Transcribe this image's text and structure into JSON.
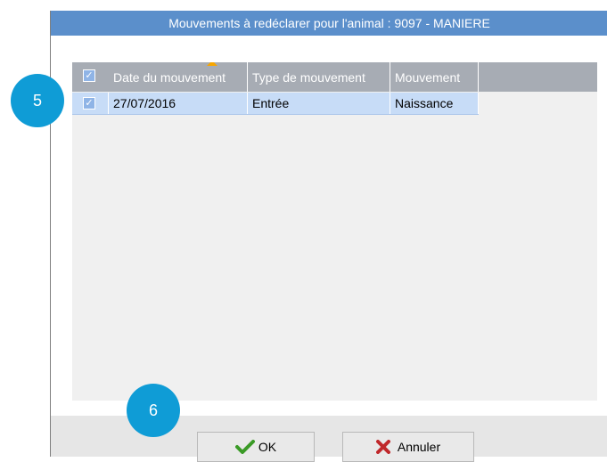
{
  "dialog": {
    "title": "Mouvements à redéclarer pour l'animal : 9097 - MANIERE"
  },
  "grid": {
    "columns": [
      "Date du mouvement",
      "Type de mouvement",
      "Mouvement"
    ],
    "sorted_column": "Date du mouvement",
    "rows": [
      {
        "checked": true,
        "date": "27/07/2016",
        "type": "Entrée",
        "mouvement": "Naissance"
      }
    ]
  },
  "buttons": {
    "ok_label": "OK",
    "cancel_label": "Annuler"
  },
  "callouts": [
    "5",
    "6"
  ],
  "colors": {
    "title_bar": "#5b8fcb",
    "header": "#a7acb4",
    "selected_row": "#c7dcf7",
    "callout": "#0f9cd6",
    "ok_check": "#3a9a26",
    "cancel_x": "#c0282b"
  },
  "icons": {
    "ok": "check-icon",
    "cancel": "close-icon",
    "sort": "sort-ascending-icon"
  }
}
